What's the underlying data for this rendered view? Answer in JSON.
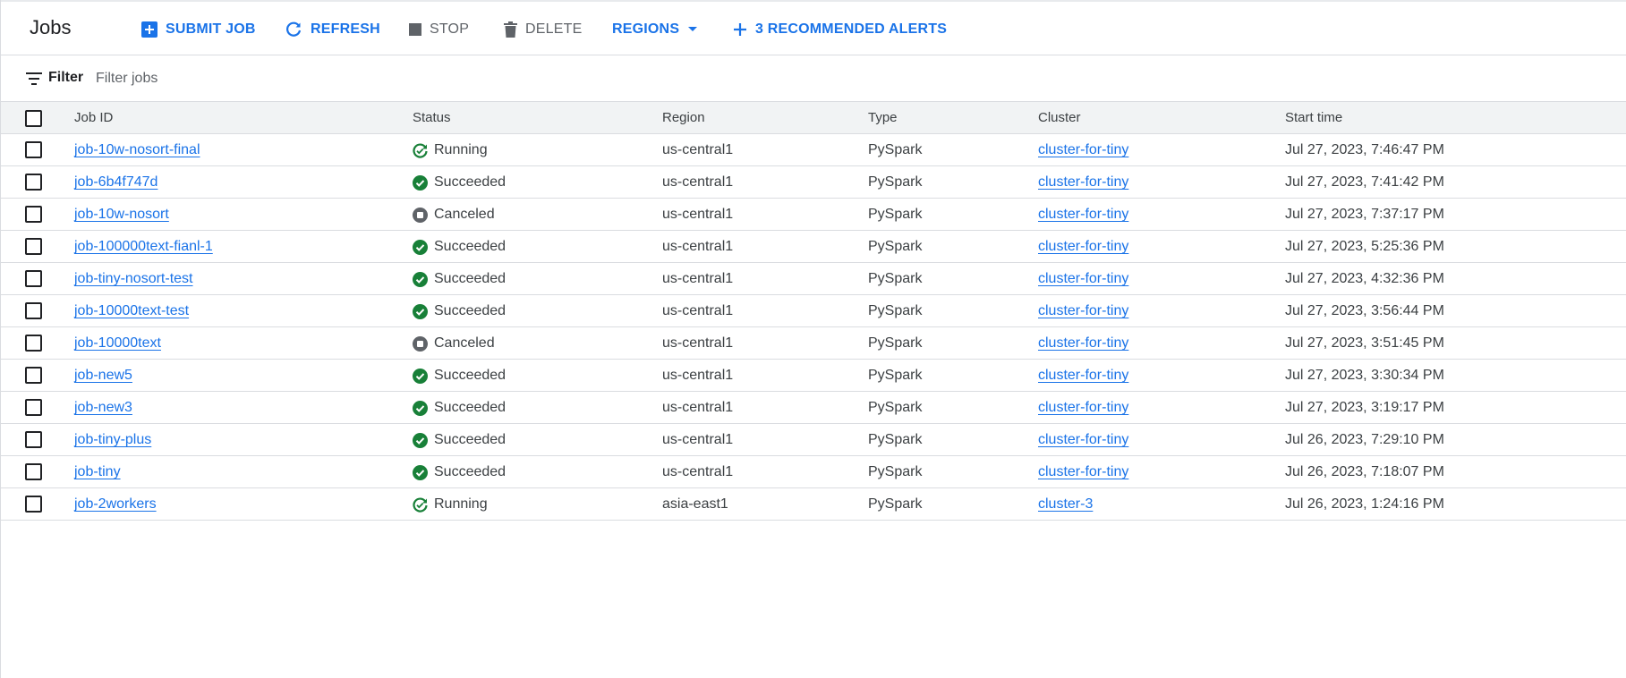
{
  "header": {
    "title": "Jobs",
    "submit_job": "SUBMIT JOB",
    "refresh": "REFRESH",
    "stop": "STOP",
    "delete": "DELETE",
    "regions": "REGIONS",
    "recommended_alerts": "3 RECOMMENDED ALERTS"
  },
  "filter": {
    "label": "Filter",
    "placeholder": "Filter jobs"
  },
  "table": {
    "columns": {
      "job_id": "Job ID",
      "status": "Status",
      "region": "Region",
      "type": "Type",
      "cluster": "Cluster",
      "start_time": "Start time"
    },
    "rows": [
      {
        "job_id": "job-10w-nosort-final",
        "status": "Running",
        "status_icon": "running-icon",
        "region": "us-central1",
        "type": "PySpark",
        "cluster": "cluster-for-tiny",
        "start_time": "Jul 27, 2023, 7:46:47 PM"
      },
      {
        "job_id": "job-6b4f747d",
        "status": "Succeeded",
        "status_icon": "check-circle-icon",
        "region": "us-central1",
        "type": "PySpark",
        "cluster": "cluster-for-tiny",
        "start_time": "Jul 27, 2023, 7:41:42 PM"
      },
      {
        "job_id": "job-10w-nosort",
        "status": "Canceled",
        "status_icon": "stop-circle-icon",
        "region": "us-central1",
        "type": "PySpark",
        "cluster": "cluster-for-tiny",
        "start_time": "Jul 27, 2023, 7:37:17 PM"
      },
      {
        "job_id": "job-100000text-fianl-1",
        "status": "Succeeded",
        "status_icon": "check-circle-icon",
        "region": "us-central1",
        "type": "PySpark",
        "cluster": "cluster-for-tiny",
        "start_time": "Jul 27, 2023, 5:25:36 PM"
      },
      {
        "job_id": "job-tiny-nosort-test",
        "status": "Succeeded",
        "status_icon": "check-circle-icon",
        "region": "us-central1",
        "type": "PySpark",
        "cluster": "cluster-for-tiny",
        "start_time": "Jul 27, 2023, 4:32:36 PM"
      },
      {
        "job_id": "job-10000text-test",
        "status": "Succeeded",
        "status_icon": "check-circle-icon",
        "region": "us-central1",
        "type": "PySpark",
        "cluster": "cluster-for-tiny",
        "start_time": "Jul 27, 2023, 3:56:44 PM"
      },
      {
        "job_id": "job-10000text",
        "status": "Canceled",
        "status_icon": "stop-circle-icon",
        "region": "us-central1",
        "type": "PySpark",
        "cluster": "cluster-for-tiny",
        "start_time": "Jul 27, 2023, 3:51:45 PM"
      },
      {
        "job_id": "job-new5",
        "status": "Succeeded",
        "status_icon": "check-circle-icon",
        "region": "us-central1",
        "type": "PySpark",
        "cluster": "cluster-for-tiny",
        "start_time": "Jul 27, 2023, 3:30:34 PM"
      },
      {
        "job_id": "job-new3",
        "status": "Succeeded",
        "status_icon": "check-circle-icon",
        "region": "us-central1",
        "type": "PySpark",
        "cluster": "cluster-for-tiny",
        "start_time": "Jul 27, 2023, 3:19:17 PM"
      },
      {
        "job_id": "job-tiny-plus",
        "status": "Succeeded",
        "status_icon": "check-circle-icon",
        "region": "us-central1",
        "type": "PySpark",
        "cluster": "cluster-for-tiny",
        "start_time": "Jul 26, 2023, 7:29:10 PM"
      },
      {
        "job_id": "job-tiny",
        "status": "Succeeded",
        "status_icon": "check-circle-icon",
        "region": "us-central1",
        "type": "PySpark",
        "cluster": "cluster-for-tiny",
        "start_time": "Jul 26, 2023, 7:18:07 PM"
      },
      {
        "job_id": "job-2workers",
        "status": "Running",
        "status_icon": "running-icon",
        "region": "asia-east1",
        "type": "PySpark",
        "cluster": "cluster-3",
        "start_time": "Jul 26, 2023, 1:24:16 PM"
      }
    ]
  },
  "colors": {
    "accent": "#1a73e8",
    "success": "#188038",
    "neutral": "#5f6368",
    "text": "#202124"
  }
}
